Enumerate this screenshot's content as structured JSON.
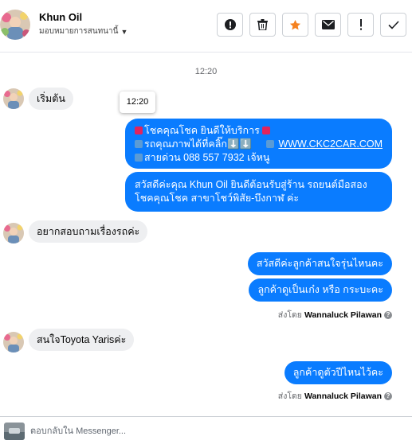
{
  "header": {
    "contact_name": "Khun Oil",
    "assign_label": "มอบหมายการสนทนานี้",
    "tools": [
      {
        "name": "spam-icon",
        "color": "#1c1e21"
      },
      {
        "name": "trash-icon",
        "color": "#1c1e21"
      },
      {
        "name": "star-icon",
        "color": "#f5811f"
      },
      {
        "name": "mail-icon",
        "color": "#1c1e21"
      },
      {
        "name": "exclamation-icon",
        "color": "#1c1e21"
      },
      {
        "name": "check-icon",
        "color": "#1c1e21"
      }
    ]
  },
  "conversation": {
    "timestamp": "12:20",
    "tooltip": "12:20",
    "messages": {
      "m1": "เริ่มต้น",
      "m2_line1": "โชคคุณโชค ยินดีให้บริการ",
      "m2_line2": "รถคุณภาพได้ที่คลิ๊ก⬇️⬇️",
      "m2_link": "WWW.CKC2CAR.COM",
      "m2_line3": "สายด่วน 088 557 7932 เจ้หนู",
      "m3": "สวัสดีค่ะคุณ Khun Oil ยินดีต้อนรับสู่ร้าน รถยนต์มือสอง โชคคุณโชค สาขาโชว์พิสัย-บึงกาฬ ค่ะ",
      "m4": "อยากสอบถามเรื่องรถค่ะ",
      "m5": "สวัสดีค่ะลูกค้าสนใจรุ่นไหนคะ",
      "m6": "ลูกค้าดูเป็นเก๋ง หรือ กระบะคะ",
      "m7": "สนใจToyota Yarisค่ะ",
      "m8": "ลูกค้าดูตัวปีไหนไว้คะ"
    },
    "sent_by_prefix": "ส่งโดย",
    "sent_by_name": "Wannaluck Pilawan",
    "colors": {
      "outgoing": "#0a7cff",
      "incoming": "#eeeff1"
    }
  },
  "composer": {
    "placeholder": "ตอบกลับใน Messenger..."
  }
}
